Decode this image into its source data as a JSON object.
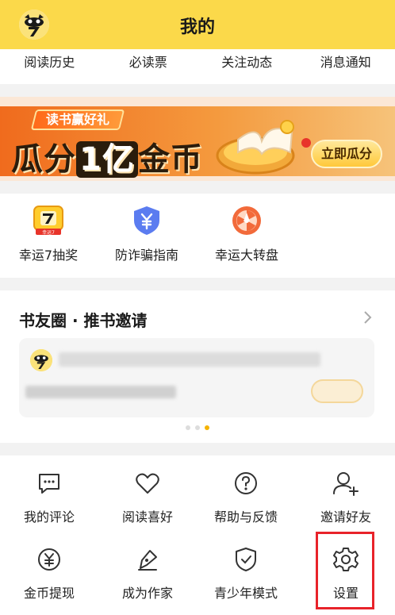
{
  "header": {
    "title": "我的"
  },
  "quick_links": [
    "阅读历史",
    "必读票",
    "关注动态",
    "消息通知"
  ],
  "banner": {
    "tag": "读书赢好礼",
    "headline_a": "瓜分",
    "headline_b": "1亿",
    "headline_c": "金币",
    "cta": "立即瓜分"
  },
  "tools": [
    {
      "label": "幸运7抽奖",
      "icon": "lucky7-icon",
      "badge": "幸运7"
    },
    {
      "label": "防诈骗指南",
      "icon": "shield-yen-icon"
    },
    {
      "label": "幸运大转盘",
      "icon": "wheel-icon"
    }
  ],
  "book_circle": {
    "title": "书友圈 · 推书邀请"
  },
  "menu": [
    {
      "label": "我的评论",
      "icon": "comment-icon"
    },
    {
      "label": "阅读喜好",
      "icon": "heart-icon"
    },
    {
      "label": "帮助与反馈",
      "icon": "help-icon"
    },
    {
      "label": "邀请好友",
      "icon": "add-user-icon"
    },
    {
      "label": "金币提现",
      "icon": "coin-icon"
    },
    {
      "label": "成为作家",
      "icon": "pen-icon"
    },
    {
      "label": "青少年模式",
      "icon": "shield-check-icon"
    },
    {
      "label": "设置",
      "icon": "gear-icon"
    }
  ],
  "colors": {
    "brand_yellow": "#fbd94a",
    "highlight_red": "#e8232a",
    "dot_active": "#f5b300"
  }
}
